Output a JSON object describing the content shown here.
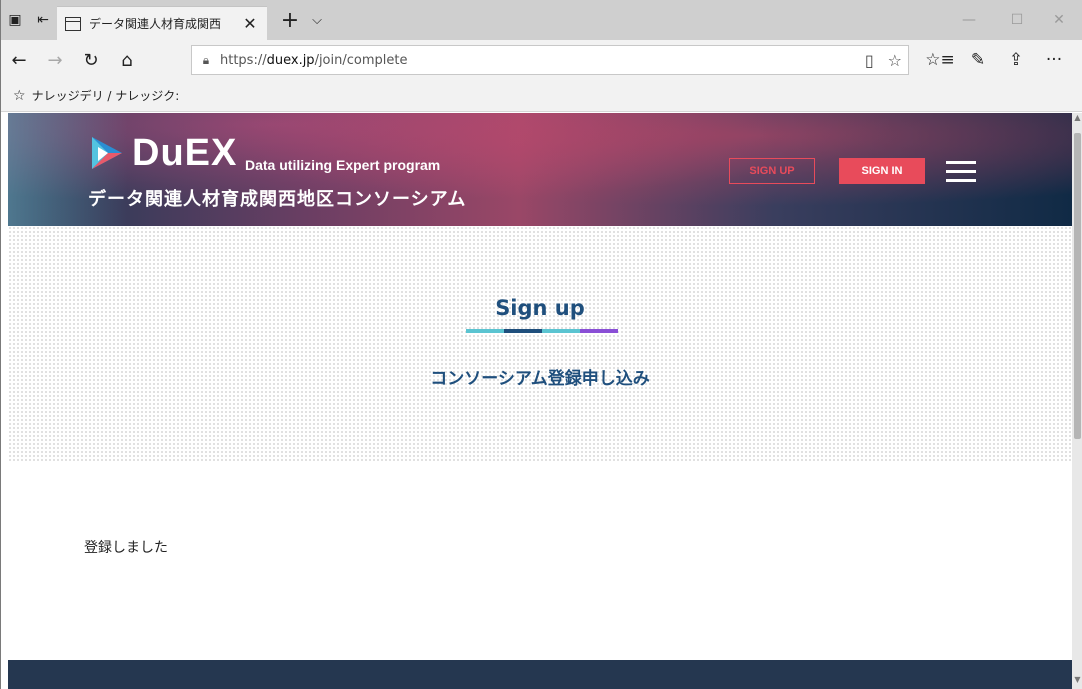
{
  "browser": {
    "tab_title": "データ関連人材育成関西",
    "url_scheme": "https://",
    "url_host": "duex.jp",
    "url_path": "/join/complete",
    "favorite_label": "ナレッジデリ / ナレッジク:",
    "icons": {
      "tab_actions": "tab-actions-icon",
      "set_aside": "set-aside-icon",
      "tab_page": "page-icon",
      "close": "close-icon",
      "new_tab": "plus-icon",
      "tab_menu": "chevron-down-icon",
      "minimize": "minimize-icon",
      "maximize": "maximize-icon",
      "window_close": "close-icon",
      "back": "back-arrow-icon",
      "forward": "forward-arrow-icon",
      "refresh": "refresh-icon",
      "home": "home-icon",
      "lock": "lock-icon",
      "reading_view": "reading-view-icon",
      "favorite": "star-icon",
      "favorites_hub": "favorites-list-icon",
      "notes": "pen-icon",
      "share": "share-icon",
      "more": "more-icon"
    }
  },
  "site": {
    "logo_text": "DuEX",
    "logo_tagline": "Data utilizing Expert program",
    "logo_subtitle": "データ関連人材育成関西地区コンソーシアム",
    "signup_label": "SIGN UP",
    "signin_label": "SIGN IN",
    "colors": {
      "accent": "#e84b5b",
      "title": "#1f4f7d",
      "footer": "#253750",
      "underline": [
        "#5bc4d1",
        "#1f4f7d",
        "#5bc4d1",
        "#8a4fd6"
      ]
    }
  },
  "hero": {
    "title": "Sign up",
    "subtitle": "コンソーシアム登録申し込み"
  },
  "content": {
    "message": "登録しました"
  }
}
